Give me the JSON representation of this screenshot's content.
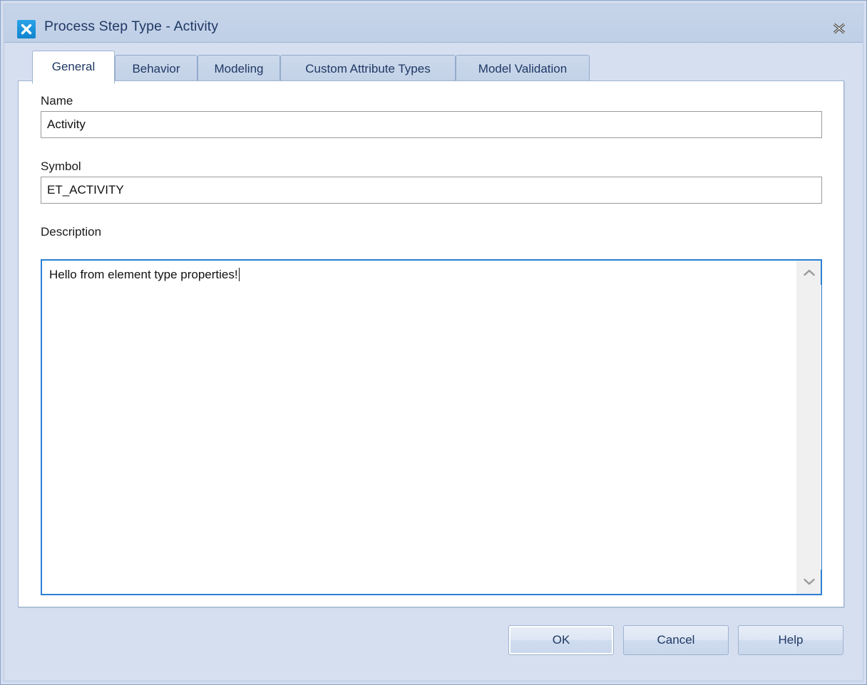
{
  "window": {
    "title": "Process Step Type - Activity",
    "app_icon": "app-logo-icon",
    "close_icon": "close-icon",
    "colors": {
      "titlebar": "#c3d2e8",
      "dialog_background": "#d6dff0",
      "content_background": "#ffffff",
      "accent_focus": "#2a7fd4",
      "text": "#1f3864",
      "app_icon": "#1184cf"
    }
  },
  "tabs": [
    {
      "label": "General",
      "active": true
    },
    {
      "label": "Behavior",
      "active": false
    },
    {
      "label": "Modeling",
      "active": false
    },
    {
      "label": "Custom Attribute Types",
      "active": false
    },
    {
      "label": "Model Validation",
      "active": false
    }
  ],
  "general_tab": {
    "name": {
      "label": "Name",
      "value": "Activity",
      "placeholder": ""
    },
    "symbol": {
      "label": "Symbol",
      "value": "ET_ACTIVITY",
      "placeholder": ""
    },
    "description": {
      "label": "Description",
      "value": "Hello from element type properties!",
      "placeholder": "",
      "focused": true,
      "scroll_up_icon": "chevron-up-icon",
      "scroll_down_icon": "chevron-down-icon"
    }
  },
  "footer": {
    "ok_label": "OK",
    "cancel_label": "Cancel",
    "help_label": "Help"
  }
}
